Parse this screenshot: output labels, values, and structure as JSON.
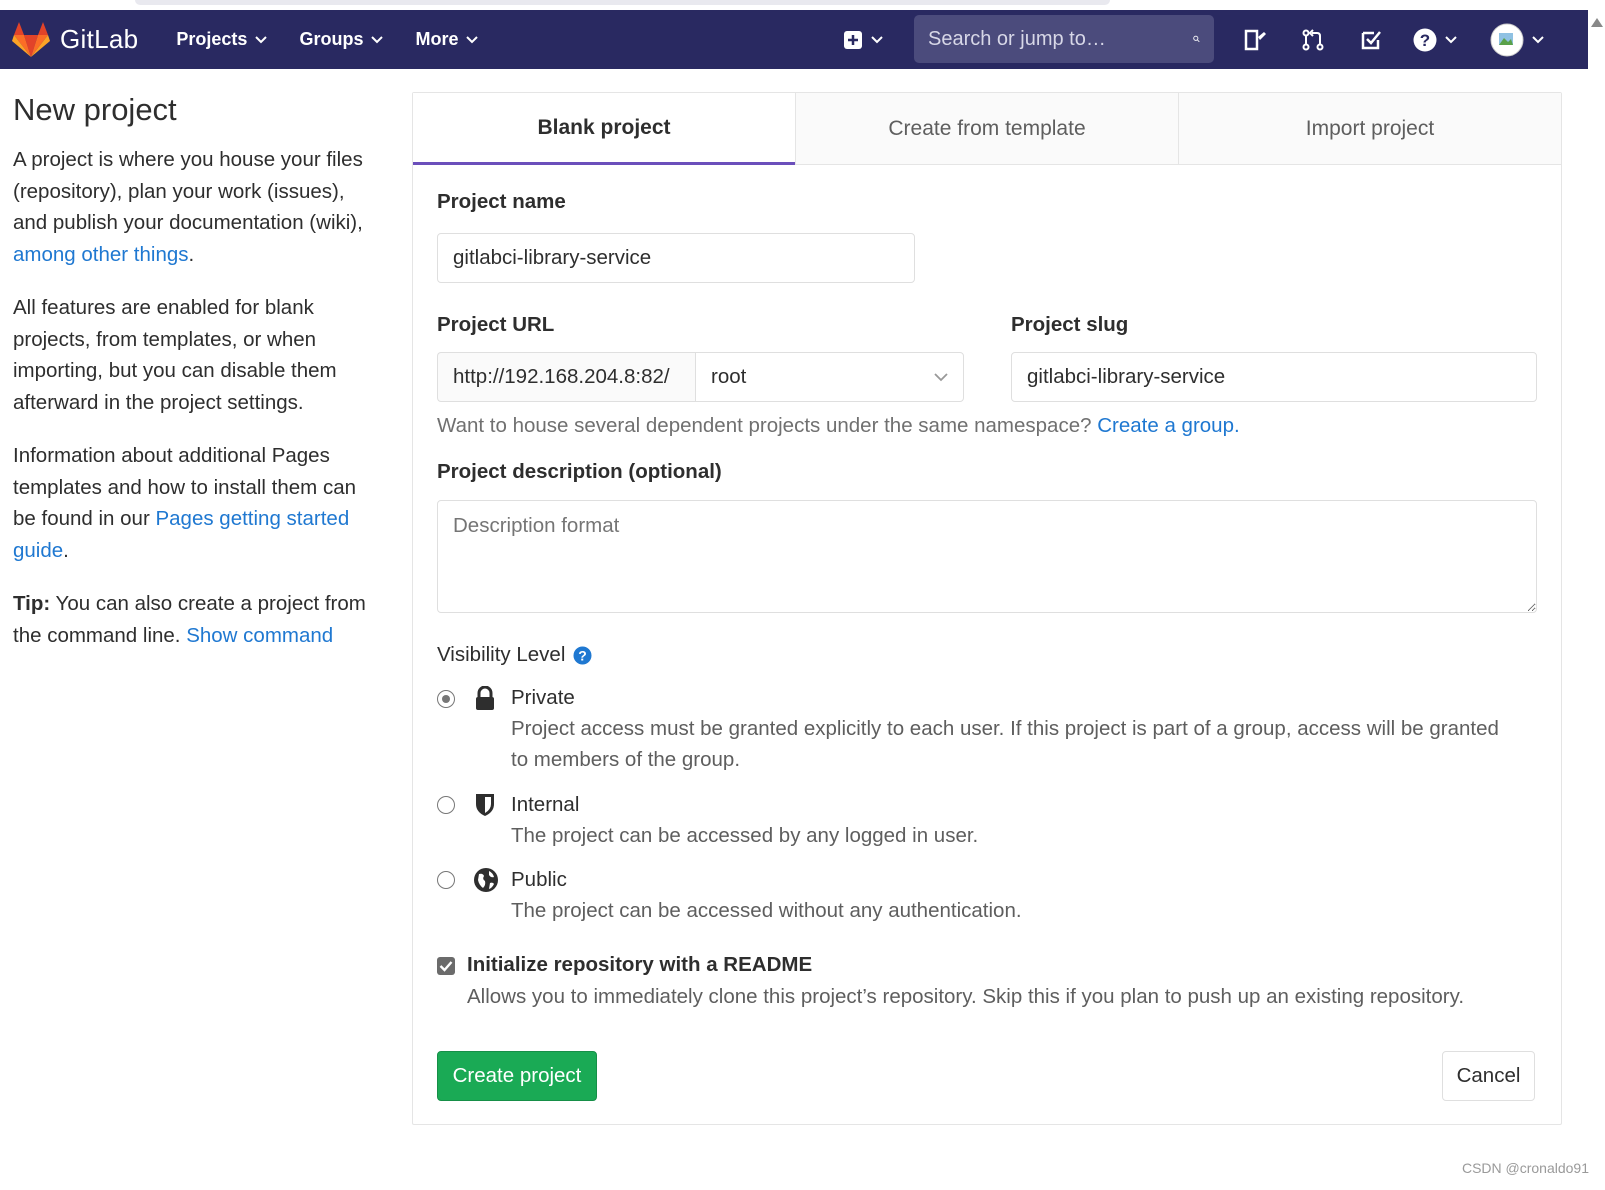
{
  "brand": {
    "name": "GitLab"
  },
  "nav": {
    "items": [
      {
        "label": "Projects"
      },
      {
        "label": "Groups"
      },
      {
        "label": "More"
      }
    ],
    "search_placeholder": "Search or jump to…"
  },
  "sidebar": {
    "title": "New project",
    "p1_text": "A project is where you house your files (repository), plan your work (issues), and publish your documentation (wiki), ",
    "p1_link": "among other things",
    "p1_end": ".",
    "p2_text": "All features are enabled for blank projects, from templates, or when importing, but you can disable them afterward in the project settings.",
    "p3_text": "Information about additional Pages templates and how to install them can be found in our ",
    "p3_link": "Pages getting started guide",
    "p3_end": ".",
    "tip_label": "Tip:",
    "tip_text": " You can also create a project from the command line. ",
    "tip_link": "Show command"
  },
  "tabs": [
    {
      "label": "Blank project",
      "active": true
    },
    {
      "label": "Create from template",
      "active": false
    },
    {
      "label": "Import project",
      "active": false
    }
  ],
  "form": {
    "project_name_label": "Project name",
    "project_name_value": "gitlabci-library-service",
    "project_url_label": "Project URL",
    "project_url_prefix": "http://192.168.204.8:82/",
    "namespace_value": "root",
    "project_slug_label": "Project slug",
    "project_slug_value": "gitlabci-library-service",
    "namespace_hint": "Want to house several dependent projects under the same namespace? ",
    "namespace_hint_link": "Create a group.",
    "description_label": "Project description (optional)",
    "description_placeholder": "Description format",
    "visibility_label": "Visibility Level",
    "visibility_options": [
      {
        "title": "Private",
        "desc": "Project access must be granted explicitly to each user. If this project is part of a group, access will be granted to members of the group.",
        "selected": true
      },
      {
        "title": "Internal",
        "desc": "The project can be accessed by any logged in user.",
        "selected": false
      },
      {
        "title": "Public",
        "desc": "The project can be accessed without any authentication.",
        "selected": false
      }
    ],
    "readme_label": "Initialize repository with a README",
    "readme_desc": "Allows you to immediately clone this project’s repository. Skip this if you plan to push up an existing repository.",
    "readme_checked": true,
    "create_button": "Create project",
    "cancel_button": "Cancel"
  },
  "watermark": "CSDN @cronaldo91",
  "colors": {
    "navbar": "#292961",
    "link": "#1f78d1",
    "primary_button": "#1aaa55",
    "active_tab": "#6b4fbb"
  }
}
